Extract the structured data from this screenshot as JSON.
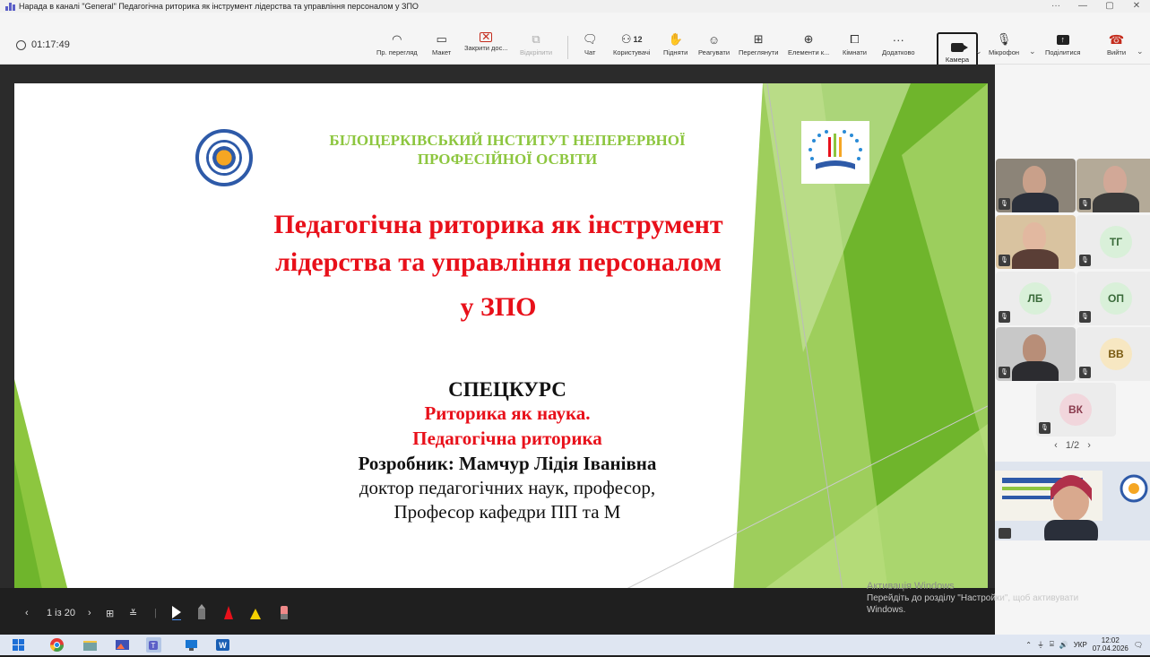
{
  "window": {
    "title": "Нарада в каналі \"General\" Педагогічна риторика як інструмент лідерства та управління персоналом у ЗПО",
    "controls": [
      "···",
      "—",
      "▢",
      "✕"
    ]
  },
  "meeting": {
    "timer": "01:17:49"
  },
  "toolbar": {
    "preview_label": "Пр. перегляд",
    "layout_label": "Макет",
    "close_doc_label": "Закрити дос...",
    "undock_label": "Відкріпити",
    "chat_label": "Чат",
    "people_count": "12",
    "people_label": "Користувачі",
    "raise_label": "Підняти",
    "react_label": "Реагувати",
    "view_label": "Переглянути",
    "apps_label": "Елементи к...",
    "rooms_label": "Кімнати",
    "more_label": "Додатково",
    "camera_label": "Камера",
    "mic_label": "Мікрофон",
    "share_label": "Поділитися",
    "leave_label": "Вийти"
  },
  "slide": {
    "institute_line1": "БІЛОЦЕРКІВСЬКИЙ ІНСТИТУТ НЕПЕРЕРВНОЇ",
    "institute_line2": "ПРОФЕСІЙНОЇ ОСВІТИ",
    "title_line1": "Педагогічна риторика як інструмент",
    "title_line2": "лідерства та управління персоналом",
    "title_line3": "у ЗПО",
    "course": "СПЕЦКУРС",
    "topic_line1": "Риторика як наука.",
    "topic_line2": "Педагогічна риторика",
    "author": "Розробник: Мамчур Лідія Іванівна",
    "degree": "доктор педагогічних наук, професор,",
    "position": "Професор кафедри ПП та М"
  },
  "slide_controls": {
    "page_indicator": "1 із 20"
  },
  "participants": [
    {
      "initials": "",
      "type": "photo"
    },
    {
      "initials": "",
      "type": "photo"
    },
    {
      "initials": "",
      "type": "photo"
    },
    {
      "initials": "ТГ",
      "type": "avatar",
      "color": "#d9f0d9",
      "text_color": "#3a6b3a"
    },
    {
      "initials": "ЛБ",
      "type": "avatar",
      "color": "#d9f0d9",
      "text_color": "#3a6b3a"
    },
    {
      "initials": "ОП",
      "type": "avatar",
      "color": "#d9f0d9",
      "text_color": "#3a6b3a"
    },
    {
      "initials": "",
      "type": "photo"
    },
    {
      "initials": "ВВ",
      "type": "avatar",
      "color": "#f7e7c2",
      "text_color": "#7a5a10"
    },
    {
      "initials": "ВК",
      "type": "avatar",
      "color": "#f1d6dc",
      "text_color": "#8a3b4d"
    }
  ],
  "pager": {
    "text": "1/2"
  },
  "activation": {
    "line1": "Активація Windows",
    "line2": "Перейдіть до розділу \"Настройки\", щоб активувати",
    "line3": "Windows."
  },
  "taskbar": {
    "lang": "УКР",
    "time": "12:02",
    "date": "07.04.2026"
  }
}
